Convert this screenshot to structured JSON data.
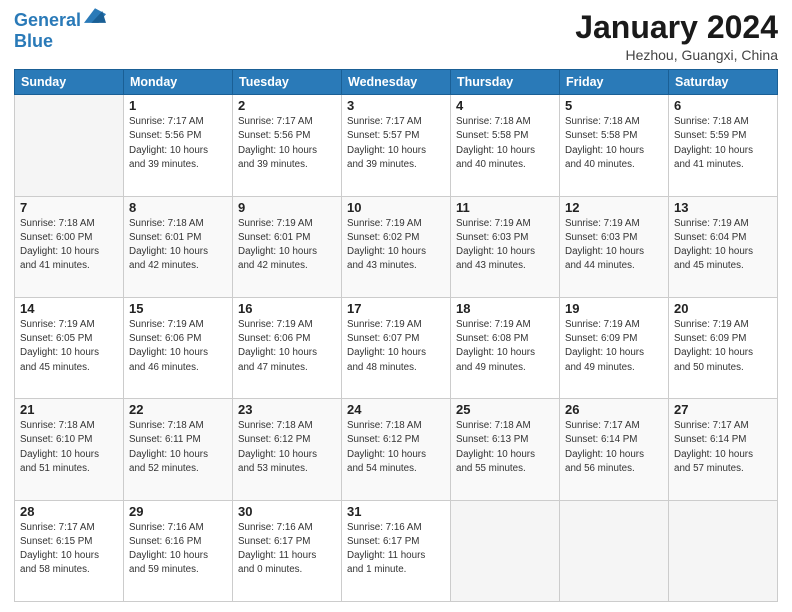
{
  "logo": {
    "line1": "General",
    "line2": "Blue"
  },
  "header": {
    "month": "January 2024",
    "location": "Hezhou, Guangxi, China"
  },
  "weekdays": [
    "Sunday",
    "Monday",
    "Tuesday",
    "Wednesday",
    "Thursday",
    "Friday",
    "Saturday"
  ],
  "weeks": [
    [
      {
        "day": null,
        "info": null
      },
      {
        "day": "1",
        "info": "Sunrise: 7:17 AM\nSunset: 5:56 PM\nDaylight: 10 hours\nand 39 minutes."
      },
      {
        "day": "2",
        "info": "Sunrise: 7:17 AM\nSunset: 5:56 PM\nDaylight: 10 hours\nand 39 minutes."
      },
      {
        "day": "3",
        "info": "Sunrise: 7:17 AM\nSunset: 5:57 PM\nDaylight: 10 hours\nand 39 minutes."
      },
      {
        "day": "4",
        "info": "Sunrise: 7:18 AM\nSunset: 5:58 PM\nDaylight: 10 hours\nand 40 minutes."
      },
      {
        "day": "5",
        "info": "Sunrise: 7:18 AM\nSunset: 5:58 PM\nDaylight: 10 hours\nand 40 minutes."
      },
      {
        "day": "6",
        "info": "Sunrise: 7:18 AM\nSunset: 5:59 PM\nDaylight: 10 hours\nand 41 minutes."
      }
    ],
    [
      {
        "day": "7",
        "info": "Sunrise: 7:18 AM\nSunset: 6:00 PM\nDaylight: 10 hours\nand 41 minutes."
      },
      {
        "day": "8",
        "info": "Sunrise: 7:18 AM\nSunset: 6:01 PM\nDaylight: 10 hours\nand 42 minutes."
      },
      {
        "day": "9",
        "info": "Sunrise: 7:19 AM\nSunset: 6:01 PM\nDaylight: 10 hours\nand 42 minutes."
      },
      {
        "day": "10",
        "info": "Sunrise: 7:19 AM\nSunset: 6:02 PM\nDaylight: 10 hours\nand 43 minutes."
      },
      {
        "day": "11",
        "info": "Sunrise: 7:19 AM\nSunset: 6:03 PM\nDaylight: 10 hours\nand 43 minutes."
      },
      {
        "day": "12",
        "info": "Sunrise: 7:19 AM\nSunset: 6:03 PM\nDaylight: 10 hours\nand 44 minutes."
      },
      {
        "day": "13",
        "info": "Sunrise: 7:19 AM\nSunset: 6:04 PM\nDaylight: 10 hours\nand 45 minutes."
      }
    ],
    [
      {
        "day": "14",
        "info": "Sunrise: 7:19 AM\nSunset: 6:05 PM\nDaylight: 10 hours\nand 45 minutes."
      },
      {
        "day": "15",
        "info": "Sunrise: 7:19 AM\nSunset: 6:06 PM\nDaylight: 10 hours\nand 46 minutes."
      },
      {
        "day": "16",
        "info": "Sunrise: 7:19 AM\nSunset: 6:06 PM\nDaylight: 10 hours\nand 47 minutes."
      },
      {
        "day": "17",
        "info": "Sunrise: 7:19 AM\nSunset: 6:07 PM\nDaylight: 10 hours\nand 48 minutes."
      },
      {
        "day": "18",
        "info": "Sunrise: 7:19 AM\nSunset: 6:08 PM\nDaylight: 10 hours\nand 49 minutes."
      },
      {
        "day": "19",
        "info": "Sunrise: 7:19 AM\nSunset: 6:09 PM\nDaylight: 10 hours\nand 49 minutes."
      },
      {
        "day": "20",
        "info": "Sunrise: 7:19 AM\nSunset: 6:09 PM\nDaylight: 10 hours\nand 50 minutes."
      }
    ],
    [
      {
        "day": "21",
        "info": "Sunrise: 7:18 AM\nSunset: 6:10 PM\nDaylight: 10 hours\nand 51 minutes."
      },
      {
        "day": "22",
        "info": "Sunrise: 7:18 AM\nSunset: 6:11 PM\nDaylight: 10 hours\nand 52 minutes."
      },
      {
        "day": "23",
        "info": "Sunrise: 7:18 AM\nSunset: 6:12 PM\nDaylight: 10 hours\nand 53 minutes."
      },
      {
        "day": "24",
        "info": "Sunrise: 7:18 AM\nSunset: 6:12 PM\nDaylight: 10 hours\nand 54 minutes."
      },
      {
        "day": "25",
        "info": "Sunrise: 7:18 AM\nSunset: 6:13 PM\nDaylight: 10 hours\nand 55 minutes."
      },
      {
        "day": "26",
        "info": "Sunrise: 7:17 AM\nSunset: 6:14 PM\nDaylight: 10 hours\nand 56 minutes."
      },
      {
        "day": "27",
        "info": "Sunrise: 7:17 AM\nSunset: 6:14 PM\nDaylight: 10 hours\nand 57 minutes."
      }
    ],
    [
      {
        "day": "28",
        "info": "Sunrise: 7:17 AM\nSunset: 6:15 PM\nDaylight: 10 hours\nand 58 minutes."
      },
      {
        "day": "29",
        "info": "Sunrise: 7:16 AM\nSunset: 6:16 PM\nDaylight: 10 hours\nand 59 minutes."
      },
      {
        "day": "30",
        "info": "Sunrise: 7:16 AM\nSunset: 6:17 PM\nDaylight: 11 hours\nand 0 minutes."
      },
      {
        "day": "31",
        "info": "Sunrise: 7:16 AM\nSunset: 6:17 PM\nDaylight: 11 hours\nand 1 minute."
      },
      {
        "day": null,
        "info": null
      },
      {
        "day": null,
        "info": null
      },
      {
        "day": null,
        "info": null
      }
    ]
  ]
}
